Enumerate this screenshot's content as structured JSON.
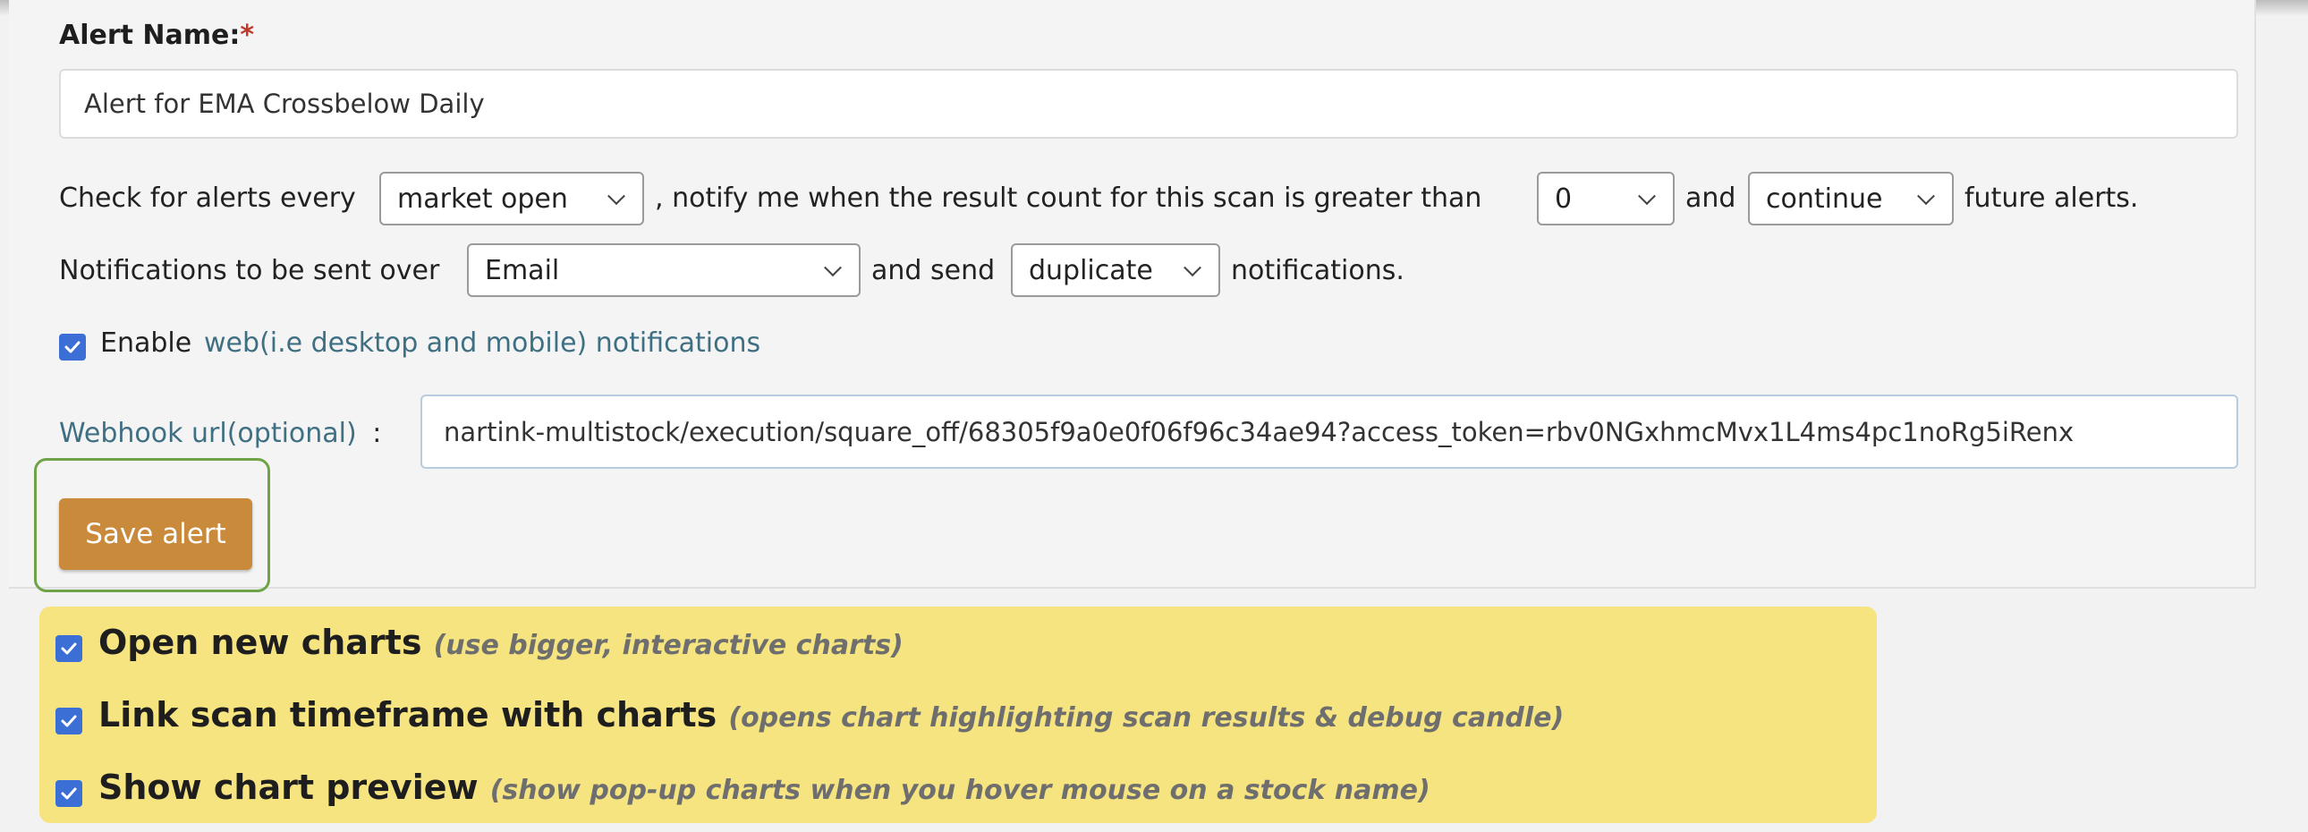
{
  "alert_form": {
    "name_label": "Alert Name:",
    "required_mark": "*",
    "name_value": "Alert for EMA Crossbelow Daily",
    "row1": {
      "prefix": "Check for alerts every",
      "frequency": "market open",
      "middle": ", notify me when the result count for this scan is greater than",
      "threshold": "0",
      "and_text": "and",
      "continue_value": "continue",
      "suffix": "future alerts."
    },
    "row2": {
      "prefix": "Notifications to be sent over",
      "channel": "Email",
      "middle": "and send",
      "duplicate_value": "duplicate",
      "suffix": "notifications."
    },
    "web_notifications": {
      "checked": true,
      "enable_text": "Enable",
      "link_text": "web(i.e desktop and mobile) notifications"
    },
    "webhook": {
      "label": "Webhook url(optional)",
      "colon": ":",
      "value": "nartink-multistock/execution/square_off/68305f9a0e0f06f96c34ae94?access_token=rbv0NGxhmcMvx1L4ms4pc1noRg5iRenx"
    },
    "save_label": "Save alert"
  },
  "chart_options": [
    {
      "checked": true,
      "title": "Open new charts",
      "hint": "(use bigger, interactive charts)"
    },
    {
      "checked": true,
      "title": "Link scan timeframe with charts",
      "hint": "(opens chart highlighting scan results & debug candle)"
    },
    {
      "checked": true,
      "title": "Show chart preview",
      "hint": "(show pop-up charts when you hover mouse on a stock name)"
    }
  ],
  "colors": {
    "save_button": "#c98a3b",
    "checkbox": "#3b6fd6",
    "options_panel": "#f5e47f",
    "highlight_outline": "#6ea347",
    "link": "#3f6f83"
  }
}
